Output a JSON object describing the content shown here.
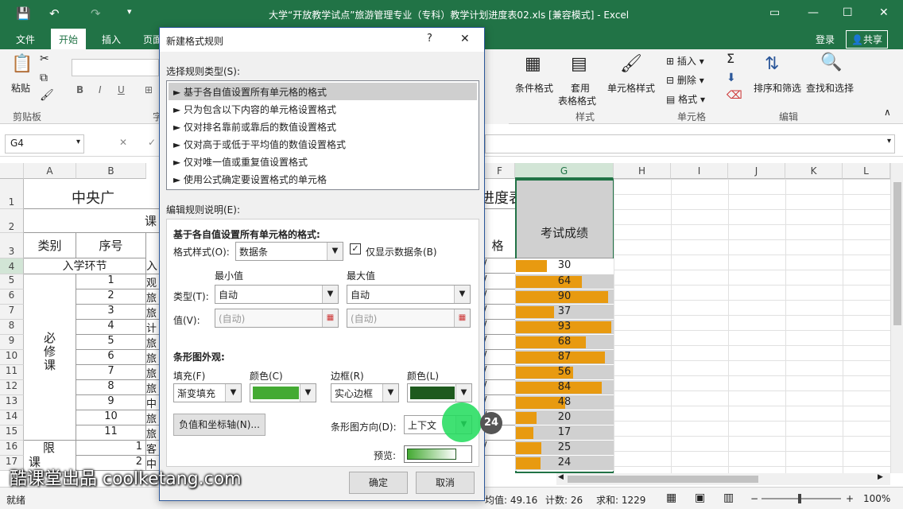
{
  "title": "大学“开放教学试点”旅游管理专业（专科）教学计划进度表02.xls [兼容模式] - Excel",
  "tabs": [
    "文件",
    "开始",
    "插入",
    "页面"
  ],
  "login": "登录",
  "share": "共享",
  "ribbon": {
    "paste": "粘贴",
    "clipboard": "剪贴板",
    "cond_format": "条件格式",
    "table_format1": "套用",
    "table_format2": "表格格式",
    "cell_style": "单元格样式",
    "insert": "插入",
    "delete": "删除",
    "format": "格式",
    "sort": "排序和筛选",
    "find": "查找和选择",
    "g_style": "样式",
    "g_cells": "单元格",
    "g_edit": "编辑",
    "g_font": "字"
  },
  "namebox": "G4",
  "columns": [
    "A",
    "B",
    "",
    "",
    "",
    "",
    "",
    "G",
    "H",
    "I",
    "J",
    "K",
    "L"
  ],
  "rows": [
    "1",
    "2",
    "3",
    "4",
    "5",
    "6",
    "7",
    "8",
    "9",
    "10",
    "11",
    "12",
    "13",
    "14",
    "15",
    "16",
    "17"
  ],
  "sheet": {
    "title_left": "中央广",
    "title_right": "进度表",
    "row2": "课",
    "hdr_cat": "类别",
    "hdr_num": "序号",
    "hdr_g": "考试成绩",
    "hdr_f": "格",
    "r4": "入学环节",
    "r4c": "入",
    "bixiu": "必\n修\n课",
    "xian": "限",
    "ke": "课",
    "nums": [
      "1",
      "2",
      "3",
      "4",
      "5",
      "6",
      "7",
      "8",
      "9",
      "10",
      "11"
    ],
    "r16": "1",
    "r17": "2",
    "c_chars": [
      "观",
      "旅",
      "旅",
      "计",
      "旅",
      "旅",
      "旅",
      "旅",
      "中",
      "旅",
      "旅"
    ],
    "r16c": "客",
    "r17c": "中",
    "fchk": "/"
  },
  "scores": [
    30,
    64,
    90,
    37,
    93,
    68,
    87,
    56,
    84,
    48,
    20,
    17,
    25,
    24
  ],
  "status": {
    "ready": "就绪",
    "avg": "均值: 49.16",
    "count": "计数: 26",
    "sum": "求和: 1229",
    "zoom": "100%"
  },
  "dialog": {
    "title": "新建格式规则",
    "help": "?",
    "close": "✕",
    "select_type": "选择规则类型(S):",
    "rules": [
      "► 基于各自值设置所有单元格的格式",
      "► 只为包含以下内容的单元格设置格式",
      "► 仅对排名靠前或靠后的数值设置格式",
      "► 仅对高于或低于平均值的数值设置格式",
      "► 仅对唯一值或重复值设置格式",
      "► 使用公式确定要设置格式的单元格"
    ],
    "edit_desc": "编辑规则说明(E):",
    "based_on": "基于各自值设置所有单元格的格式:",
    "style_label": "格式样式(O):",
    "style_value": "数据条",
    "show_bar_only": "仅显示数据条(B)",
    "min": "最小值",
    "max": "最大值",
    "type_label": "类型(T):",
    "type_min": "自动",
    "type_max": "自动",
    "value_label": "值(V):",
    "value_min": "(自动)",
    "value_max": "(自动)",
    "bar_appearance": "条形图外观:",
    "fill": "填充(F)",
    "fill_value": "渐变填充",
    "color1": "颜色(C)",
    "border": "边框(R)",
    "border_value": "实心边框",
    "color2": "颜色(L)",
    "neg_axis": "负值和坐标轴(N)...",
    "bar_dir": "条形图方向(D):",
    "bar_dir_value": "上下文",
    "preview": "预览:",
    "ok": "确定",
    "cancel": "取消",
    "fill_color": "#44aa33",
    "border_color": "#1e5a1e"
  },
  "badge": "24",
  "watermark": "酷课堂出品 coolketang.com"
}
